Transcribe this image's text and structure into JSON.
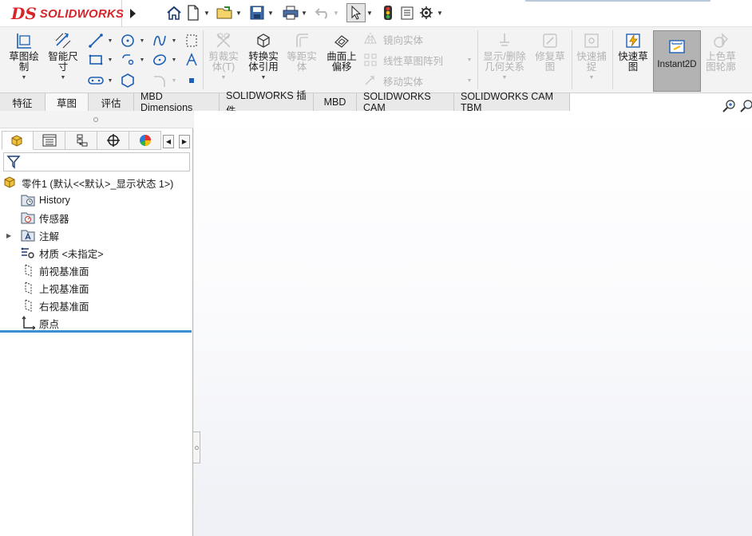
{
  "app": {
    "logo_mark": "DS",
    "brand": "SOLIDWORKS"
  },
  "quick_access": [
    {
      "name": "home-icon"
    },
    {
      "name": "new-document-icon"
    },
    {
      "name": "open-folder-icon"
    },
    {
      "name": "save-icon"
    },
    {
      "name": "print-icon"
    },
    {
      "name": "undo-icon"
    },
    {
      "name": "select-cursor-icon"
    },
    {
      "name": "rebuild-traffic-light-icon"
    },
    {
      "name": "file-properties-icon"
    },
    {
      "name": "options-gear-icon"
    }
  ],
  "commands": {
    "sketch": "草图绘\n制",
    "smart_dim": "智能尺\n寸",
    "trim": "剪裁实\n体(T)",
    "convert": "转换实\n体引用",
    "offset": "等距实\n体",
    "offset_surface": "曲面上\n偏移",
    "mirror": "镜向实体",
    "linear_pattern": "线性草图阵列",
    "move": "移动实体",
    "display_relations": "显示/删除\n几何关系",
    "repair": "修复草\n图",
    "quick_snaps": "快速捕\n捉",
    "rapid_sketch": "快速草\n图",
    "instant2d": "Instant2D",
    "shaded_contours": "上色草\n图轮廓"
  },
  "tabs": [
    {
      "label": "特征",
      "active": false
    },
    {
      "label": "草图",
      "active": true
    },
    {
      "label": "评估",
      "active": false
    },
    {
      "label": "MBD Dimensions",
      "active": false
    },
    {
      "label": "SOLIDWORKS 插件",
      "active": false
    },
    {
      "label": "MBD",
      "active": false
    },
    {
      "label": "SOLIDWORKS CAM",
      "active": false
    },
    {
      "label": "SOLIDWORKS CAM TBM",
      "active": false
    }
  ],
  "panel_tabs": [
    {
      "name": "featuremanager-tab-icon"
    },
    {
      "name": "propertymanager-tab-icon"
    },
    {
      "name": "configurationmanager-tab-icon"
    },
    {
      "name": "dimxpert-tab-icon"
    },
    {
      "name": "displaymanager-tab-icon"
    }
  ],
  "tree": {
    "root": "零件1  (默认<<默认>_显示状态 1>)",
    "items": [
      {
        "label": "History",
        "icon": "history-folder-icon"
      },
      {
        "label": "传感器",
        "icon": "sensors-icon"
      },
      {
        "label": "注解",
        "icon": "annotations-icon",
        "expandable": true
      },
      {
        "label": "材质 <未指定>",
        "icon": "material-icon"
      },
      {
        "label": "前视基准面",
        "icon": "plane-icon"
      },
      {
        "label": "上视基准面",
        "icon": "plane-icon"
      },
      {
        "label": "右视基准面",
        "icon": "plane-icon"
      },
      {
        "label": "原点",
        "icon": "origin-icon"
      }
    ]
  },
  "colors": {
    "brand_red": "#d6242a",
    "rollback_blue": "#3d8fd1",
    "instant2d_bg": "#b3b3b3"
  }
}
